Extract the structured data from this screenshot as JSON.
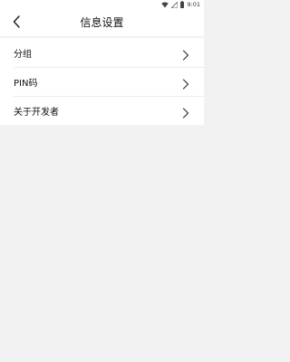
{
  "status_bar": {
    "time": "9:01",
    "icons": [
      "wifi-icon",
      "signal-icon",
      "battery-icon"
    ]
  },
  "header": {
    "title": "信息设置",
    "back_icon": "back-chevron-icon"
  },
  "menu": {
    "items": [
      {
        "label": "分组",
        "icon": "chevron-right-icon"
      },
      {
        "label": "PIN码",
        "icon": "chevron-right-icon"
      },
      {
        "label": "关于开发者",
        "icon": "chevron-right-icon"
      }
    ]
  },
  "colors": {
    "background": "#f2f2f2",
    "surface": "#ffffff",
    "divider": "#ececec",
    "text": "#111111"
  }
}
